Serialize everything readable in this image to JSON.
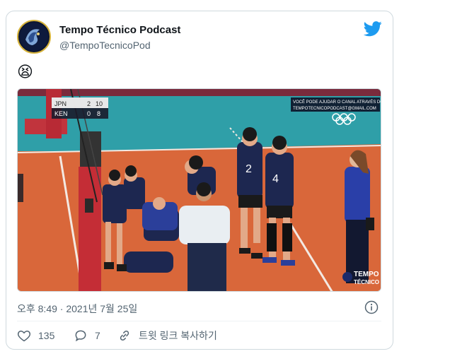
{
  "tweet": {
    "display_name": "Tempo Técnico Podcast",
    "handle": "@TempoTecnicoPod",
    "emoji": "😫",
    "timestamp": "오후 8:49 · 2021년 7월 25일",
    "likes": "135",
    "replies": "7",
    "share_label": "트윗 링크 복사하기"
  },
  "media": {
    "scoreboard": {
      "rows": [
        {
          "team": "JPN",
          "sets": "2",
          "points": "10"
        },
        {
          "team": "KEN",
          "sets": "0",
          "points": "8"
        }
      ]
    },
    "overlay_line1": "VOCÊ PODE AJUDAR O CANAL ATRAVÉS DO PIX",
    "overlay_line2": "TEMPOTECNICOPODCAST@GMAIL.COM",
    "watermark_line1": "TEMPO",
    "watermark_line2": "TÉCNICO",
    "jersey_numbers": [
      "2",
      "4"
    ]
  },
  "colors": {
    "court_orange": "#d9673a",
    "court_teal": "#2f9fa8",
    "twitter_blue": "#1d9bf0"
  }
}
